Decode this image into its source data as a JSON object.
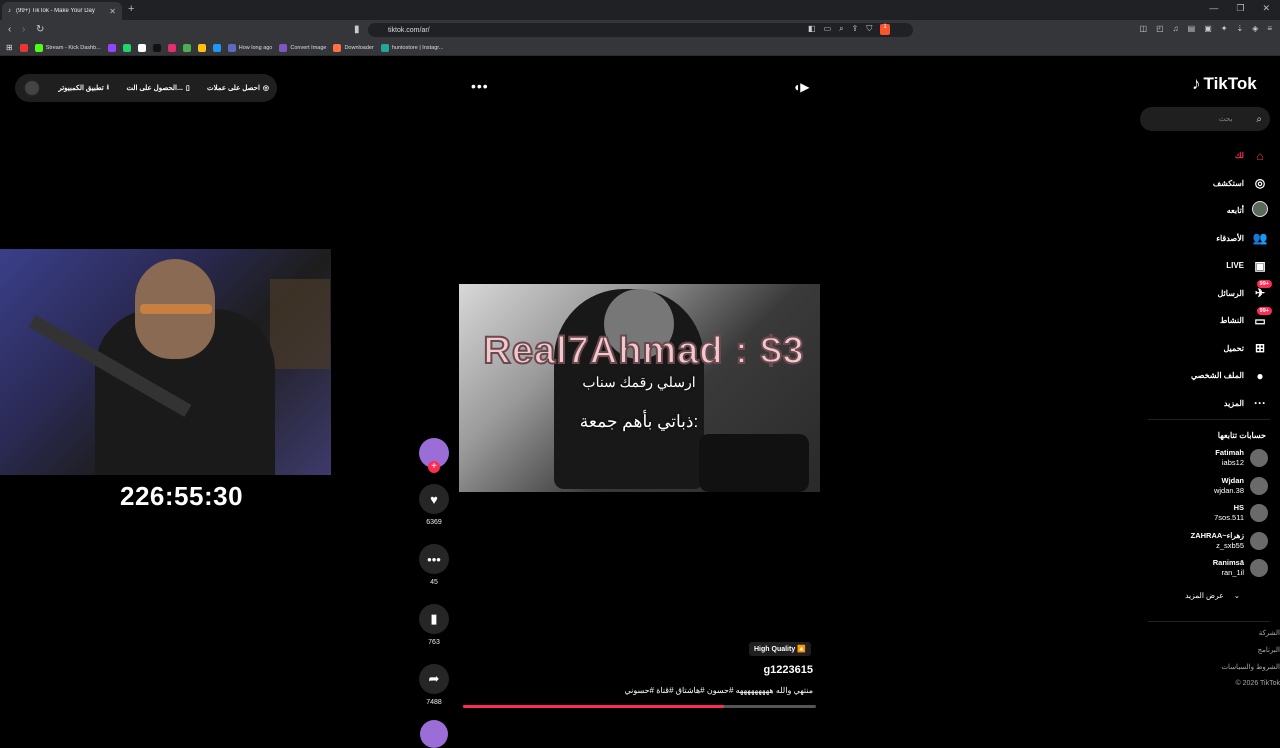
{
  "browser": {
    "tab_title": "(99+) TikTok - Make Your Day",
    "url": "tiktok.com/ar/",
    "brave_count": "1",
    "bookmarks": [
      {
        "label": "",
        "color": "#e33"
      },
      {
        "label": "Stream - Kick Dashb...",
        "color": "#53fc18"
      },
      {
        "label": "",
        "color": "#9146ff"
      },
      {
        "label": "",
        "color": "#25d366"
      },
      {
        "label": "",
        "color": "#fff"
      },
      {
        "label": "",
        "color": "#111"
      },
      {
        "label": "",
        "color": "#e1306c"
      },
      {
        "label": "",
        "color": "#4caf50"
      },
      {
        "label": "",
        "color": "#ffc107"
      },
      {
        "label": "",
        "color": "#2196f3"
      },
      {
        "label": "How long ago",
        "color": "#5c6bc0"
      },
      {
        "label": "Convert Image",
        "color": "#7e57c2"
      },
      {
        "label": "Downloader",
        "color": "#ff7043"
      },
      {
        "label": "huntostore | Instagr...",
        "color": "#26a69a"
      }
    ]
  },
  "top_pill": {
    "coins": "احصل على عملات",
    "get": "الحصول على الت...",
    "pc_app": "تطبيق الكمبيوتر"
  },
  "timer": "226:55:30",
  "video": {
    "caption_big": "Real7Ahmad : $3",
    "caption_line2": "ارسلي رقمك سناب",
    "caption_line3": "ذباتي بأهم جمعة:",
    "progress": 0.74
  },
  "actions": {
    "likes": "6369",
    "comments": "45",
    "saves": "763",
    "shares": "7488"
  },
  "post": {
    "quality_tag": "High Quality 🔼",
    "username": "g1223615",
    "description": "منتهي والله هههههههههه #حسون #هاشتاق #قناة #حسوني"
  },
  "sidebar": {
    "logo": "TikTok",
    "search_placeholder": "بحث",
    "menu": [
      {
        "label": "لك",
        "icon": "⌂",
        "name": "foryou"
      },
      {
        "label": "استكشف",
        "icon": "◎",
        "name": "explore"
      },
      {
        "label": "أتابعه",
        "icon": "",
        "name": "following"
      },
      {
        "label": "الأصدقاء",
        "icon": "👥",
        "name": "friends"
      },
      {
        "label": "LIVE",
        "icon": "▣",
        "name": "live"
      },
      {
        "label": "الرسائل",
        "icon": "✈",
        "name": "messages",
        "badge": "99+"
      },
      {
        "label": "النشاط",
        "icon": "▭",
        "name": "activity",
        "badge": "99+"
      },
      {
        "label": "تحميل",
        "icon": "⊞",
        "name": "upload"
      },
      {
        "label": "الملف الشخصي",
        "icon": "●",
        "name": "profile"
      },
      {
        "label": "المزيد",
        "icon": "···",
        "name": "more"
      }
    ],
    "following_title": "حسابات تتابعها",
    "accounts": [
      {
        "name": "Fatimah",
        "handle": "iabs12"
      },
      {
        "name": "Wjdan",
        "handle": "wjdan.38"
      },
      {
        "name": "HS",
        "handle": "7sos.511"
      },
      {
        "name": "ZAHRAA~زهراء",
        "handle": "z_sxb55"
      },
      {
        "name": "Ranimsā",
        "handle": "ran_1il"
      }
    ],
    "see_more": "عرض المزيد",
    "footer": [
      "الشركة",
      "البرنامج",
      "الشروط والسياسات",
      "© 2026 TikTok"
    ]
  },
  "colors": {
    "accent": "#fe2c55",
    "panel": "#1f1f1f"
  }
}
